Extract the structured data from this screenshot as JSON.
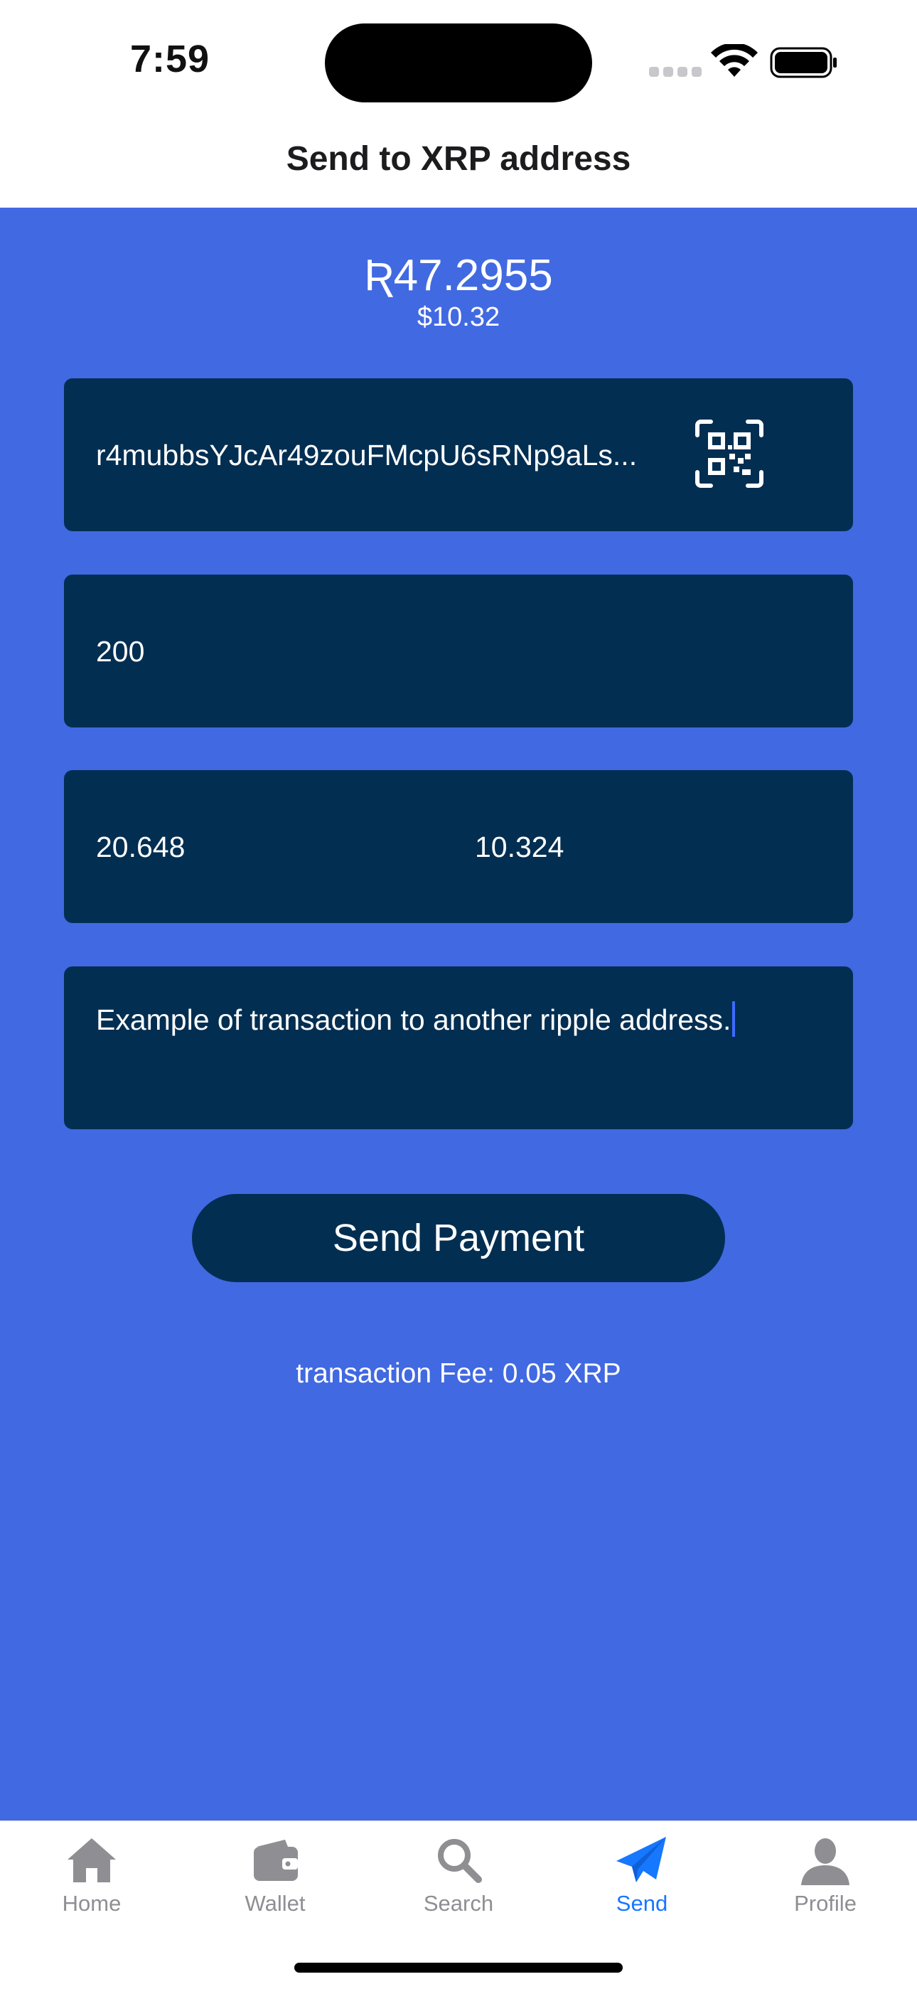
{
  "status_bar": {
    "time": "7:59"
  },
  "header": {
    "title": "Send to XRP address"
  },
  "balance": {
    "xrp": "Ʀ47.2955",
    "usd": "$10.32"
  },
  "form": {
    "address": "r4mubbsYJcAr49zouFMcpU6sRNp9aLs...",
    "amount": "200",
    "converted_left": "20.648",
    "converted_right": "10.324",
    "memo": "Example of transaction to another ripple address."
  },
  "send_button": {
    "label": "Send Payment"
  },
  "fee": {
    "text": "transaction Fee: 0.05 XRP"
  },
  "tabs": [
    {
      "label": "Home",
      "icon": "house-icon",
      "active": false
    },
    {
      "label": "Wallet",
      "icon": "wallet-icon",
      "active": false
    },
    {
      "label": "Search",
      "icon": "magnifier-icon",
      "active": false
    },
    {
      "label": "Send",
      "icon": "paper-plane-icon",
      "active": true
    },
    {
      "label": "Profile",
      "icon": "person-icon",
      "active": false
    }
  ],
  "colors": {
    "background": "#4169e1",
    "field": "#022e52",
    "active_tab": "#1677ff",
    "inactive_tab": "#8e8e93"
  }
}
